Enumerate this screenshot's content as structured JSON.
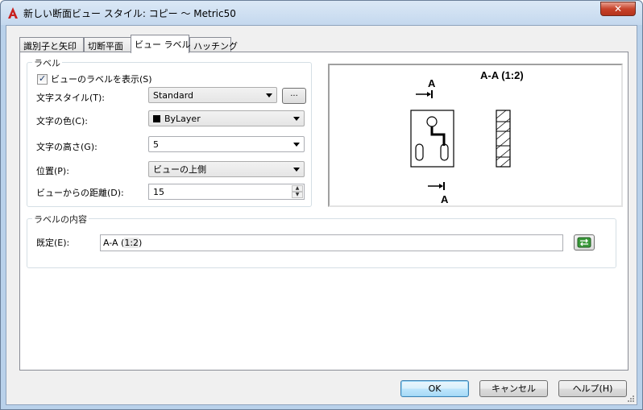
{
  "window": {
    "title": "新しい断面ビュー スタイル: コピー ～ Metric50",
    "close_glyph": "✕"
  },
  "tabs": [
    {
      "label": "識別子と矢印"
    },
    {
      "label": "切断平面"
    },
    {
      "label": "ビュー ラベル"
    },
    {
      "label": "ハッチング"
    }
  ],
  "label_group": {
    "title": "ラベル",
    "show_label": {
      "text": "ビューのラベルを表示(S)",
      "checked": true
    },
    "text_style": {
      "label": "文字スタイル(T):",
      "value": "Standard",
      "button": "..."
    },
    "text_color": {
      "label": "文字の色(C):",
      "value": "ByLayer"
    },
    "text_height": {
      "label": "文字の高さ(G):",
      "value": "5"
    },
    "position": {
      "label": "位置(P):",
      "value": "ビューの上側"
    },
    "distance": {
      "label": "ビューからの距離(D):",
      "value": "15"
    }
  },
  "preview": {
    "title": "A-A (1:2)",
    "top_marker": "A",
    "bottom_marker": "A"
  },
  "content_group": {
    "title": "ラベルの内容",
    "default_label": "既定(E):",
    "field_value_prefix": "A-A (",
    "field_value_selected": "1:2",
    "field_value_suffix": ")"
  },
  "buttons": {
    "ok": "OK",
    "cancel": "キャンセル",
    "help": "ヘルプ(H)"
  },
  "colors": {
    "accent": "#3c7fb1",
    "title_bar": "#c4d8ee",
    "close": "#c7432b"
  }
}
